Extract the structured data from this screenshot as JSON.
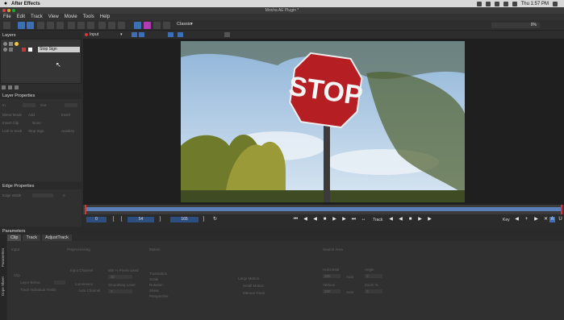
{
  "mac_menu": {
    "app": "After Effects",
    "clock": "Thu 1:57 PM"
  },
  "window": {
    "title": "Mocha AE Plugin *"
  },
  "menu": [
    "File",
    "Edit",
    "Track",
    "View",
    "Movie",
    "Tools",
    "Help"
  ],
  "toolbar": {
    "workspace": "Classic",
    "input_label": "Input",
    "zoom": "0%"
  },
  "layers_panel": {
    "title": "Layers",
    "layer_name": "Stop Sign"
  },
  "layer_properties": {
    "title": "Layer Properties",
    "rows": [
      "In",
      "Out",
      "Blend Mode",
      "Add",
      "Insert Clip",
      "None",
      "Link to track",
      "Stop Sign",
      "Autokey"
    ]
  },
  "edge_properties": {
    "title": "Edge Properties",
    "edge_width": "Edge Width",
    "edge_value": "0"
  },
  "photo": {
    "sign_text": "STOP"
  },
  "transport": {
    "in_frame": "0",
    "current_frame": "54",
    "out_frame": "165",
    "track_label": "Track",
    "key_label": "Key"
  },
  "parameters": {
    "title": "Parameters",
    "tabs": [
      "Clip",
      "Track",
      "AdjustTrack"
    ],
    "side_tabs": [
      "Parameters",
      "Dope Sheet"
    ],
    "labels": {
      "input": "Input",
      "preprocessing": "Preprocessing",
      "motion": "Motion",
      "search_area": "Search Area",
      "clip": "Clip",
      "layer_below": "Layer Below",
      "input_channel": "Input Channel",
      "luminance": "Luminance",
      "auto_channel": "Auto Channel",
      "min_pixels_used": "Min % Pixels Used",
      "smoothing_level": "Smoothing Level",
      "translation": "Translation",
      "scale": "Scale",
      "rotation": "Rotation",
      "shear": "Shear",
      "perspective": "Perspective",
      "large_motion": "Large Motion",
      "small_motion": "Small Motion",
      "manual_track": "Manual Track",
      "horizontal": "Horizontal",
      "vertical": "Vertical",
      "auto": "Auto",
      "angle": "Angle",
      "zoom_pct": "Zoom %",
      "track_individual_fields": "Track Individual Fields",
      "min_value": "30",
      "smoothing_value": "0",
      "horizontal_value": "100",
      "vertical_value": "100",
      "angle_value": "0",
      "zoom_value": "0"
    }
  }
}
